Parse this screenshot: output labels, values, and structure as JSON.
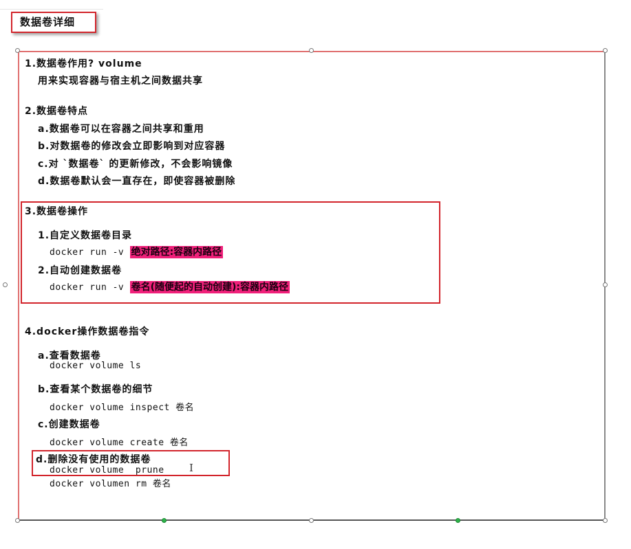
{
  "title": "数据卷详细",
  "sections": {
    "s1": {
      "heading": "1.数据卷作用? volume",
      "line1": "用来实现容器与宿主机之间数据共享"
    },
    "s2": {
      "heading": "2.数据卷特点",
      "a": "a.数据卷可以在容器之间共享和重用",
      "b": "b.对数据卷的修改会立即影响到对应容器",
      "c": "c.对 `数据卷` 的更新修改，不会影响镜像",
      "d": "d.数据卷默认会一直存在，即使容器被删除"
    },
    "s3": {
      "heading": "3.数据卷操作",
      "sub1": "1.自定义数据卷目录",
      "cmd1_prefix": "docker run -v ",
      "cmd1_hl": "绝对路径:容器内路径",
      "sub2": "2.自动创建数据卷",
      "cmd2_prefix": "docker run -v ",
      "cmd2_hl": "卷名(随便起的自动创建):容器内路径"
    },
    "s4": {
      "heading": "4.docker操作数据卷指令",
      "a": "a.查看数据卷",
      "a_cmd": "docker volume ls",
      "b": "b.查看某个数据卷的细节",
      "b_cmd": "docker volume inspect 卷名",
      "c": "c.创建数据卷",
      "c_cmd": "docker volume create 卷名",
      "d": "d.删除没有使用的数据卷",
      "d_cmd1": "docker volume  prune",
      "d_cmd2": "docker volumen rm 卷名"
    }
  },
  "colors": {
    "annotation_red": "#d2232a",
    "highlight_pink": "#f0207a",
    "handle_green": "#2db34a"
  }
}
